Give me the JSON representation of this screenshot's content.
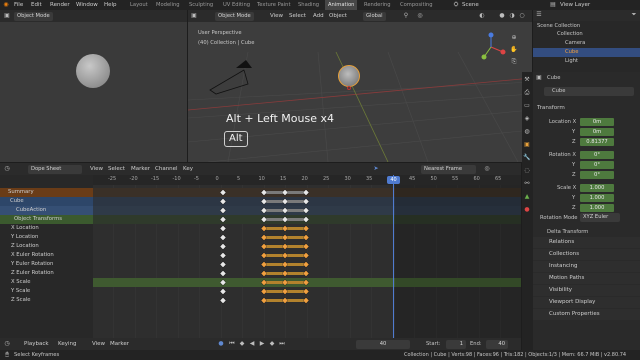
{
  "top_menu": [
    "File",
    "Edit",
    "Render",
    "Window",
    "Help"
  ],
  "workspace_tabs": [
    "Layout",
    "Modeling",
    "Sculpting",
    "UV Editing",
    "Texture Paint",
    "Shading",
    "Animation",
    "Rendering",
    "Compositing"
  ],
  "active_tab": "Animation",
  "scene_label": "Scene",
  "view_layer_label": "View Layer",
  "left_viewport": {
    "mode": "Object Mode"
  },
  "viewport": {
    "mode": "Object Mode",
    "orientation": "Global",
    "menus": [
      "View",
      "Select",
      "Add",
      "Object"
    ],
    "orientation2": "Global",
    "info_title": "User Perspective",
    "info_sub": "(40) Collection | Cube",
    "keystroke": "Alt + Left Mouse x4",
    "key_badge": "Alt"
  },
  "outliner": {
    "title": "Scene Collection",
    "items": [
      "Collection",
      "Camera",
      "Cube",
      "Light"
    ]
  },
  "properties": {
    "object_name": "Cube",
    "object_name_field": "Cube",
    "transform_title": "Transform",
    "location": {
      "label": "Location X",
      "y": "Y",
      "z": "Z",
      "values": [
        "0m",
        "0m",
        "0.81377"
      ]
    },
    "rotation": {
      "label": "Rotation X",
      "y": "Y",
      "z": "Z",
      "values": [
        "0°",
        "0°",
        "0°"
      ]
    },
    "scale": {
      "label": "Scale X",
      "y": "Y",
      "z": "Z",
      "values": [
        "1.000",
        "1.000",
        "1.000"
      ]
    },
    "rotation_mode_label": "Rotation Mode",
    "rotation_mode": "XYZ Euler",
    "delta_label": "Delta Transform",
    "panels": [
      "Relations",
      "Collections",
      "Instancing",
      "Motion Paths",
      "Visibility",
      "Viewport Display",
      "Custom Properties"
    ]
  },
  "dopesheet": {
    "editor": "Dope Sheet",
    "menus": [
      "View",
      "Select",
      "Marker",
      "Channel",
      "Key"
    ],
    "interp": "Nearest Frame",
    "ruler": [
      "-25",
      "-20",
      "-15",
      "-10",
      "-5",
      "0",
      "5",
      "10",
      "15",
      "20",
      "25",
      "30",
      "35",
      "40",
      "45",
      "50",
      "55",
      "60",
      "65"
    ],
    "current_frame": "40",
    "channels": [
      "Summary",
      "Cube",
      "CubeAction",
      "Object Transforms",
      "X Location",
      "Y Location",
      "Z Location",
      "X Euler Rotation",
      "Y Euler Rotation",
      "Z Euler Rotation",
      "X Scale",
      "Y Scale",
      "Z Scale"
    ]
  },
  "timeline": {
    "menus": [
      "Playback",
      "Keying",
      "View",
      "Marker"
    ],
    "frame": "40",
    "start_label": "Start:",
    "start": "1",
    "end_label": "End:",
    "end": "40"
  },
  "status": {
    "left": "Select Keyframes",
    "right": "Collection | Cube | Verts:98 | Faces:96 | Tris:182 | Objects:1/3 | Mem: 66.7 MiB | v2.80.74"
  }
}
